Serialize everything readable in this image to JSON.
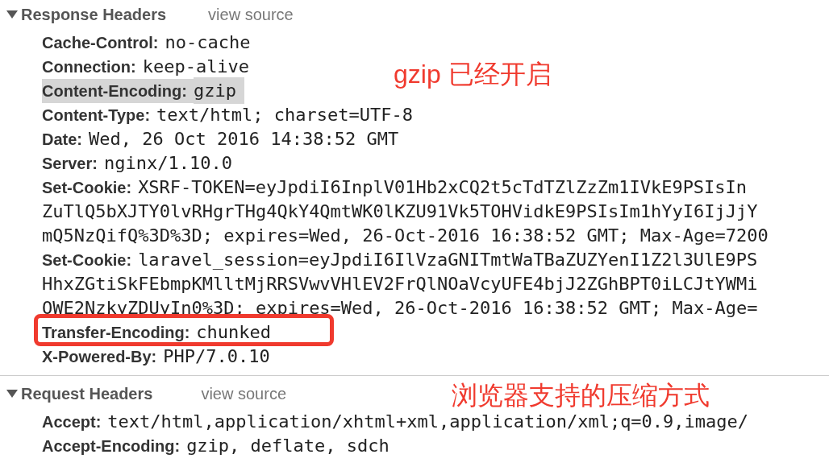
{
  "sections": [
    {
      "title": "Response Headers",
      "expanded": true,
      "view_source": "view source",
      "annotation": "gzip 已经开启",
      "headers": [
        {
          "name": "Cache-Control:",
          "lines": [
            "no-cache"
          ],
          "highlighted": false,
          "circled": false
        },
        {
          "name": "Connection:",
          "lines": [
            "keep-alive"
          ],
          "highlighted": false,
          "circled": false
        },
        {
          "name": "Content-Encoding:",
          "lines": [
            "gzip"
          ],
          "highlighted": true,
          "circled": false
        },
        {
          "name": "Content-Type:",
          "lines": [
            "text/html; charset=UTF-8"
          ],
          "highlighted": false,
          "circled": false
        },
        {
          "name": "Date:",
          "lines": [
            "Wed, 26 Oct 2016 14:38:52 GMT"
          ],
          "highlighted": false,
          "circled": false
        },
        {
          "name": "Server:",
          "lines": [
            "nginx/1.10.0"
          ],
          "highlighted": false,
          "circled": false
        },
        {
          "name": "Set-Cookie:",
          "lines": [
            "XSRF-TOKEN=eyJpdiI6InplV01Hb2xCQ2t5cTdTZlZzZm1IVkE9PSIsIn",
            "ZuTlQ5bXJTY0lvRHgrTHg4QkY4QmtWK0lKZU91Vk5TOHVidkE9PSIsIm1hYyI6IjJjY",
            "mQ5NzQifQ%3D%3D; expires=Wed, 26-Oct-2016 16:38:52 GMT; Max-Age=7200"
          ],
          "highlighted": false,
          "circled": false
        },
        {
          "name": "Set-Cookie:",
          "lines": [
            "laravel_session=eyJpdiI6IlVzaGNITmtWaTBaZUZYenI1Z2l3UlE9PS",
            "HhxZGtiSkFEbmpKMlltMjRRSVwvVHlEV2FrQlNOaVcyUFE4bjJ2ZGhBPT0iLCJtYWMi",
            "OWE2NzkyZDUyIn0%3D; expires=Wed, 26-Oct-2016 16:38:52 GMT; Max-Age="
          ],
          "highlighted": false,
          "circled": false
        },
        {
          "name": "Transfer-Encoding:",
          "lines": [
            "chunked"
          ],
          "highlighted": false,
          "circled": true
        },
        {
          "name": "X-Powered-By:",
          "lines": [
            "PHP/7.0.10"
          ],
          "highlighted": false,
          "circled": false
        }
      ]
    },
    {
      "title": "Request Headers",
      "expanded": true,
      "view_source": "view source",
      "annotation": "浏览器支持的压缩方式",
      "headers": [
        {
          "name": "Accept:",
          "lines": [
            "text/html,application/xhtml+xml,application/xml;q=0.9,image/"
          ],
          "highlighted": false,
          "circled": false
        },
        {
          "name": "Accept-Encoding:",
          "lines": [
            "gzip, deflate, sdch"
          ],
          "highlighted": false,
          "circled": false
        }
      ]
    }
  ]
}
